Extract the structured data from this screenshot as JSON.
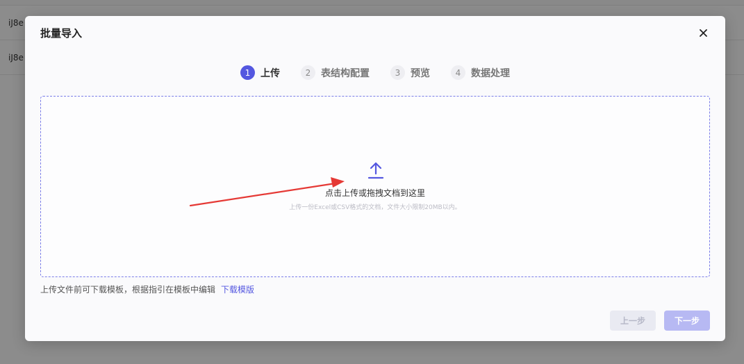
{
  "background": {
    "row1_text": "iJ8e",
    "row2_text": "iJ8e"
  },
  "modal": {
    "title": "批量导入",
    "close_icon": "close-icon"
  },
  "steps": [
    {
      "num": "1",
      "label": "上传",
      "active": true
    },
    {
      "num": "2",
      "label": "表结构配置",
      "active": false
    },
    {
      "num": "3",
      "label": "预览",
      "active": false
    },
    {
      "num": "4",
      "label": "数据处理",
      "active": false
    }
  ],
  "dropzone": {
    "icon": "upload-icon",
    "main_text": "点击上传或拖拽文档到这里",
    "sub_text": "上传一份Excel或CSV格式的文档，文件大小限制20MB以内。"
  },
  "hint": {
    "text": "上传文件前可下载模板，根据指引在模板中编辑",
    "link": "下载模版"
  },
  "buttons": {
    "prev": "上一步",
    "next": "下一步"
  },
  "colors": {
    "accent": "#5457e0",
    "next_disabled": "#b7b9f3",
    "prev_disabled": "#e9eaf2",
    "annotation_arrow": "#e53935"
  }
}
